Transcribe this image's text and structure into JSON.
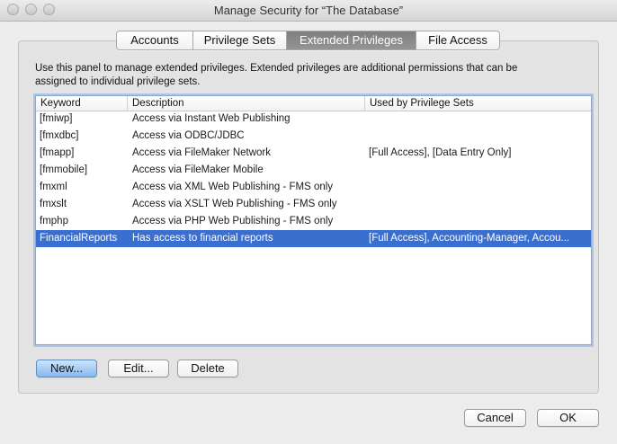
{
  "window": {
    "title": "Manage Security for “The Database”"
  },
  "tabs": [
    {
      "label": "Accounts",
      "active": false
    },
    {
      "label": "Privilege Sets",
      "active": false
    },
    {
      "label": "Extended Privileges",
      "active": true
    },
    {
      "label": "File Access",
      "active": false
    }
  ],
  "panel": {
    "description_line1": "Use this panel to manage extended privileges. Extended privileges are additional permissions that can be",
    "description_line2": "assigned to individual privilege sets."
  },
  "table": {
    "headers": [
      "Keyword",
      "Description",
      "Used by Privilege Sets"
    ],
    "rows": [
      {
        "keyword": "[fmiwp]",
        "description": "Access via Instant Web Publishing",
        "used_by": ""
      },
      {
        "keyword": "[fmxdbc]",
        "description": "Access via ODBC/JDBC",
        "used_by": ""
      },
      {
        "keyword": "[fmapp]",
        "description": "Access via FileMaker Network",
        "used_by": "[Full Access], [Data Entry Only]"
      },
      {
        "keyword": "[fmmobile]",
        "description": "Access via FileMaker Mobile",
        "used_by": ""
      },
      {
        "keyword": "fmxml",
        "description": "Access via XML Web Publishing - FMS only",
        "used_by": ""
      },
      {
        "keyword": "fmxslt",
        "description": "Access via XSLT Web Publishing - FMS only",
        "used_by": ""
      },
      {
        "keyword": "fmphp",
        "description": "Access via PHP Web Publishing - FMS only",
        "used_by": ""
      },
      {
        "keyword": "FinancialReports",
        "description": "Has access to financial reports",
        "used_by": "[Full Access], Accounting-Manager, Accou...",
        "selected": true
      }
    ]
  },
  "actions": {
    "new_label": "New...",
    "edit_label": "Edit...",
    "delete_label": "Delete"
  },
  "footer": {
    "cancel_label": "Cancel",
    "ok_label": "OK"
  },
  "colors": {
    "selection": "#3b6fcf",
    "active_tab": "#8a8a8a"
  }
}
